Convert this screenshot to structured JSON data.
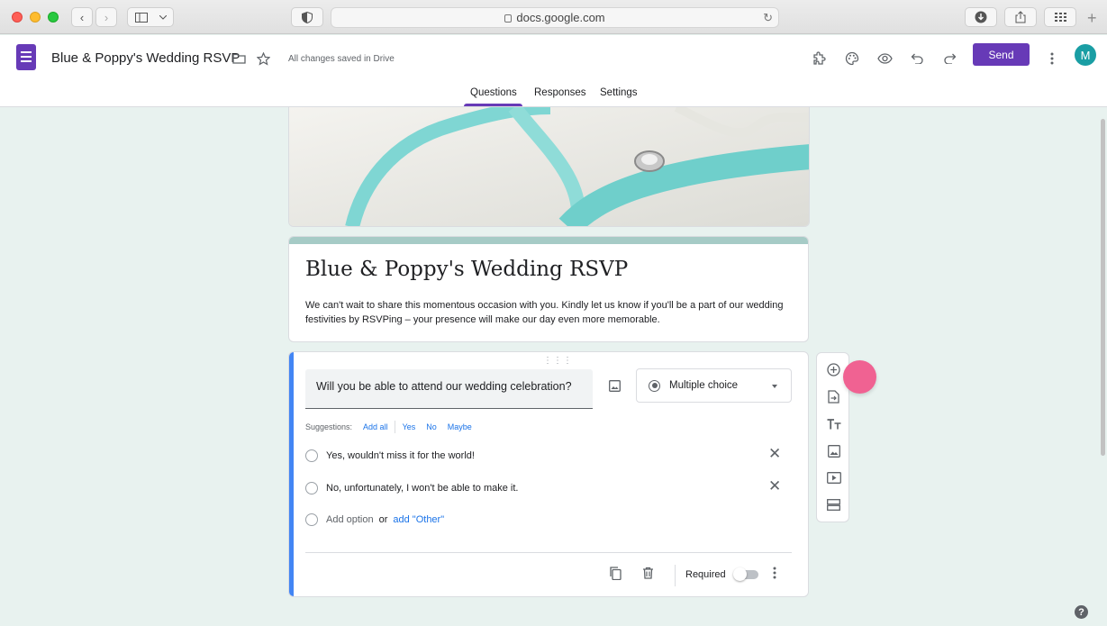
{
  "browser": {
    "url": "docs.google.com",
    "back_icon": "chevron-left-icon",
    "forward_icon": "chevron-right-icon"
  },
  "header": {
    "doc_title": "Blue & Poppy's Wedding RSVP",
    "save_status": "All changes saved in Drive",
    "send_label": "Send",
    "avatar_initial": "M",
    "accent_color": "#673ab7"
  },
  "tabs": [
    {
      "label": "Questions",
      "active": true
    },
    {
      "label": "Responses",
      "active": false
    },
    {
      "label": "Settings",
      "active": false
    }
  ],
  "form": {
    "title": "Blue & Poppy's Wedding RSVP",
    "description": "We can't wait to share this momentous occasion with you. Kindly let us know if you'll be a part of our wedding festivities by RSVPing – your presence will make our day even more memorable."
  },
  "question": {
    "text": "Will you be able to attend our wedding celebration?",
    "type": "Multiple choice",
    "suggestions_label": "Suggestions:",
    "suggestions": [
      "Add all",
      "Yes",
      "No",
      "Maybe"
    ],
    "options": [
      "Yes, wouldn't miss it for the world!",
      "No, unfortunately, I won't be able to make it."
    ],
    "add_option": "Add option",
    "or_text": "or",
    "add_other": "add \"Other\"",
    "required_label": "Required",
    "required": false
  },
  "help_label": "?"
}
